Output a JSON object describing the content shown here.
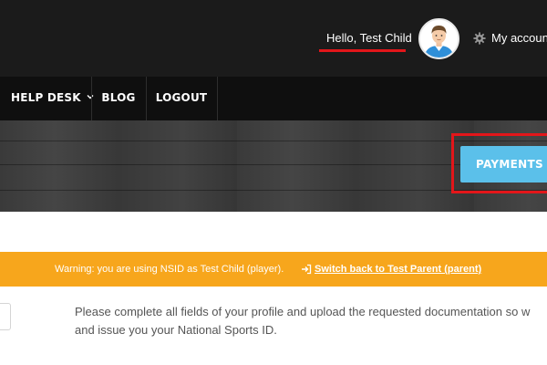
{
  "header": {
    "greeting": "Hello, Test Child",
    "account_link": "My account",
    "colors": {
      "underline": "#e3161a",
      "topbar": "#1b1b1b"
    },
    "icons": {
      "settings": "gear-icon",
      "user": "avatar"
    }
  },
  "nav": {
    "items": [
      {
        "label": "HELP DESK",
        "has_dropdown": true
      },
      {
        "label": "BLOG"
      },
      {
        "label": "LOGOUT"
      }
    ]
  },
  "hero": {
    "payments_button": "PAYMENTS",
    "colors": {
      "button": "#5bc0ea",
      "highlight": "#e3161a"
    }
  },
  "warning": {
    "text": "Warning: you are using NSID as Test Child (player).",
    "switch_link": "Switch back to Test Parent (parent)",
    "color": "#f7a61c",
    "icon": "sign-in-arrow-icon"
  },
  "profile_notice": {
    "line1": "Please complete all fields of your profile and upload the requested documentation so w",
    "line2": "and issue you your National Sports ID."
  }
}
